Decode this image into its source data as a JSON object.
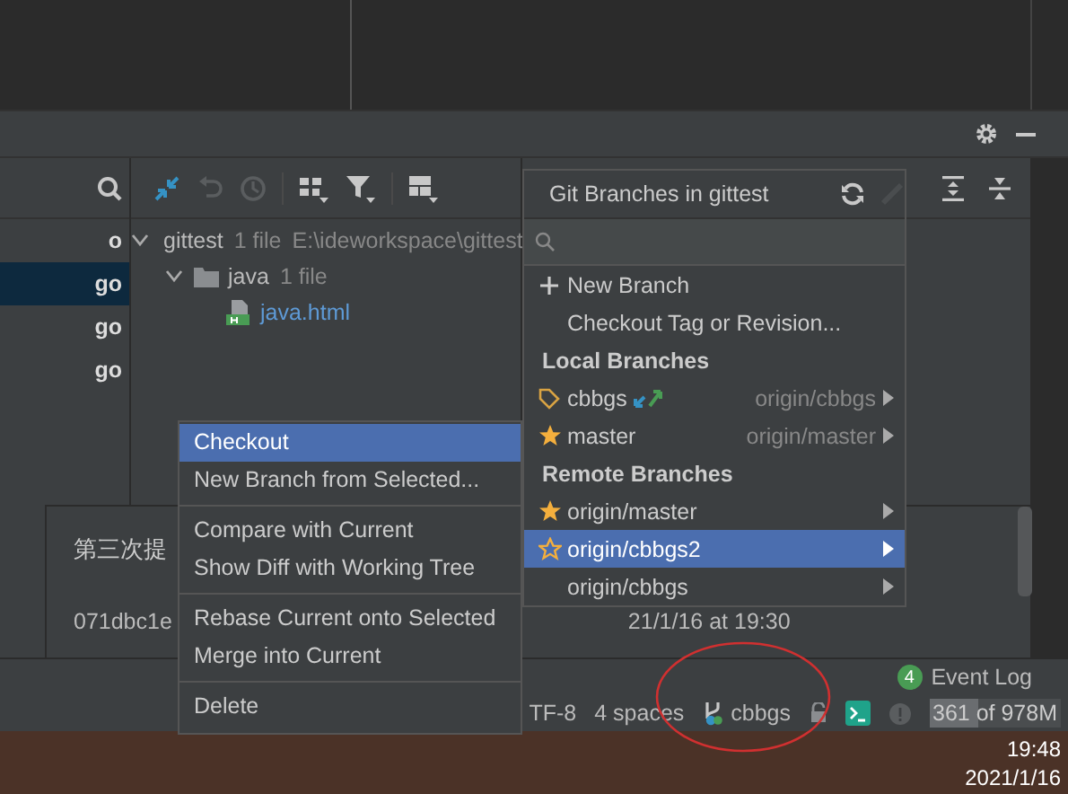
{
  "log_list": {
    "items": [
      {
        "text": "o",
        "selected": false
      },
      {
        "text": "go",
        "selected": true
      },
      {
        "text": "go",
        "selected": false
      },
      {
        "text": "go",
        "selected": false
      }
    ]
  },
  "changes_tree": {
    "children": [
      {
        "kind": "module",
        "name": "gittest",
        "count": "1 file",
        "path": "E:\\ideworkspace\\gittest",
        "expanded": true,
        "children": [
          {
            "kind": "folder",
            "name": "java",
            "count": "1 file",
            "expanded": true,
            "children": [
              {
                "kind": "file",
                "name": "java.html"
              }
            ]
          }
        ]
      }
    ]
  },
  "commit_details": {
    "message": "第三次提",
    "hash": "071dbc1e",
    "date": "21/1/16 at 19:30"
  },
  "branches_popup": {
    "title": "Git Branches in gittest",
    "items": [
      {
        "kind": "new",
        "label": "New Branch"
      },
      {
        "kind": "action",
        "label": "Checkout Tag or Revision..."
      },
      {
        "kind": "header",
        "label": "Local Branches"
      },
      {
        "kind": "branch",
        "label": "cbbgs",
        "tracking": "origin/cbbgs",
        "current": true,
        "has_updates": true,
        "favorite": false,
        "selected": false,
        "submenu": true
      },
      {
        "kind": "branch",
        "label": "master",
        "tracking": "origin/master",
        "current": false,
        "has_updates": false,
        "favorite": true,
        "selected": false,
        "submenu": true
      },
      {
        "kind": "header",
        "label": "Remote Branches"
      },
      {
        "kind": "branch",
        "label": "origin/master",
        "current": false,
        "has_updates": false,
        "favorite": true,
        "selected": false,
        "submenu": true
      },
      {
        "kind": "branch",
        "label": "origin/cbbgs2",
        "current": false,
        "has_updates": false,
        "favorite": false,
        "selected": true,
        "submenu": true
      },
      {
        "kind": "branch",
        "label": "origin/cbbgs",
        "current": false,
        "has_updates": false,
        "favorite": false,
        "selected": false,
        "submenu": true
      }
    ]
  },
  "context_menu": {
    "groups": [
      [
        {
          "label": "Checkout",
          "selected": true
        },
        {
          "label": "New Branch from Selected...",
          "selected": false
        }
      ],
      [
        {
          "label": "Compare with Current",
          "selected": false
        },
        {
          "label": "Show Diff with Working Tree",
          "selected": false
        }
      ],
      [
        {
          "label": "Rebase Current onto Selected",
          "selected": false
        },
        {
          "label": "Merge into Current",
          "selected": false
        }
      ],
      [
        {
          "label": "Delete",
          "selected": false
        }
      ]
    ]
  },
  "status_bar": {
    "event_log": {
      "count": "4",
      "label": "Event Log"
    },
    "encoding": "TF-8",
    "indent": "4 spaces",
    "branch": "cbbgs",
    "memory": {
      "text": "361 of 978M",
      "level": 0.37
    }
  },
  "taskbar": {
    "time": "19:48",
    "date": "2021/1/16"
  }
}
